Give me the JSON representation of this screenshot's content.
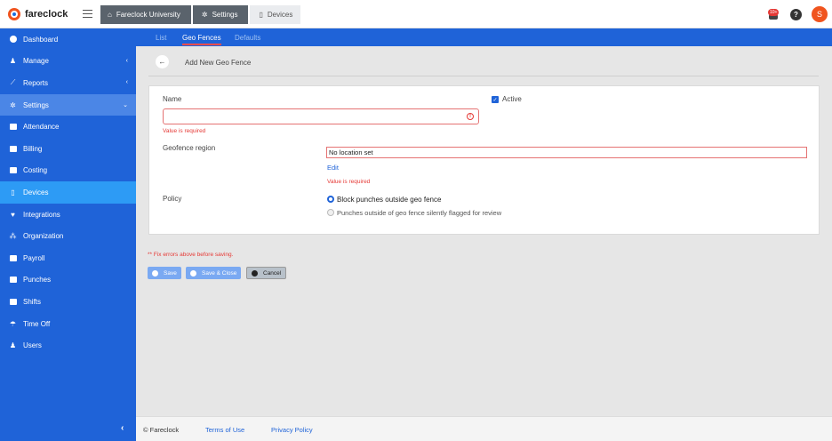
{
  "app": {
    "name": "fareclock"
  },
  "breadcrumb": [
    {
      "label": "Fareclock University",
      "icon": "home-icon"
    },
    {
      "label": "Settings",
      "icon": "gear-icon"
    },
    {
      "label": "Devices",
      "icon": "device-icon"
    }
  ],
  "header": {
    "notification_badge": "10+",
    "help_label": "?",
    "avatar_initial": "S"
  },
  "sidebar": {
    "items": [
      {
        "label": "Dashboard",
        "icon": "palette-icon"
      },
      {
        "label": "Manage",
        "icon": "user-icon",
        "chevron": "‹"
      },
      {
        "label": "Reports",
        "icon": "chart-icon",
        "chevron": "‹"
      },
      {
        "label": "Settings",
        "icon": "gear-icon",
        "chevron": "⌄"
      },
      {
        "label": "Attendance",
        "icon": "calendar-icon"
      },
      {
        "label": "Billing",
        "icon": "card-icon"
      },
      {
        "label": "Costing",
        "icon": "folder-icon"
      },
      {
        "label": "Devices",
        "icon": "tablet-icon"
      },
      {
        "label": "Integrations",
        "icon": "plug-icon"
      },
      {
        "label": "Organization",
        "icon": "sitemap-icon"
      },
      {
        "label": "Payroll",
        "icon": "money-icon"
      },
      {
        "label": "Punches",
        "icon": "car-icon"
      },
      {
        "label": "Shifts",
        "icon": "calendar-icon"
      },
      {
        "label": "Time Off",
        "icon": "umbrella-icon"
      },
      {
        "label": "Users",
        "icon": "users-icon"
      }
    ],
    "collapse_label": "‹"
  },
  "subnav": {
    "tabs": [
      "List",
      "Geo Fences",
      "Defaults"
    ],
    "active": "Geo Fences"
  },
  "page": {
    "title": "Add New Geo Fence",
    "name_label": "Name",
    "name_value": "",
    "name_error": "Value is required",
    "active_label": "Active",
    "active_checked": true,
    "region_label": "Geofence region",
    "region_value": "No location set",
    "region_edit": "Edit",
    "region_error": "Value is required",
    "policy_label": "Policy",
    "policy_options": [
      "Block punches outside geo fence",
      "Punches outside of geo fence silently flagged for review"
    ],
    "policy_selected": 0,
    "form_error": "** Fix errors above before saving.",
    "buttons": {
      "save": "Save",
      "save_close": "Save & Close",
      "cancel": "Cancel"
    }
  },
  "footer": {
    "copyright": "© Fareclock",
    "terms": "Terms of Use",
    "privacy": "Privacy Policy"
  }
}
